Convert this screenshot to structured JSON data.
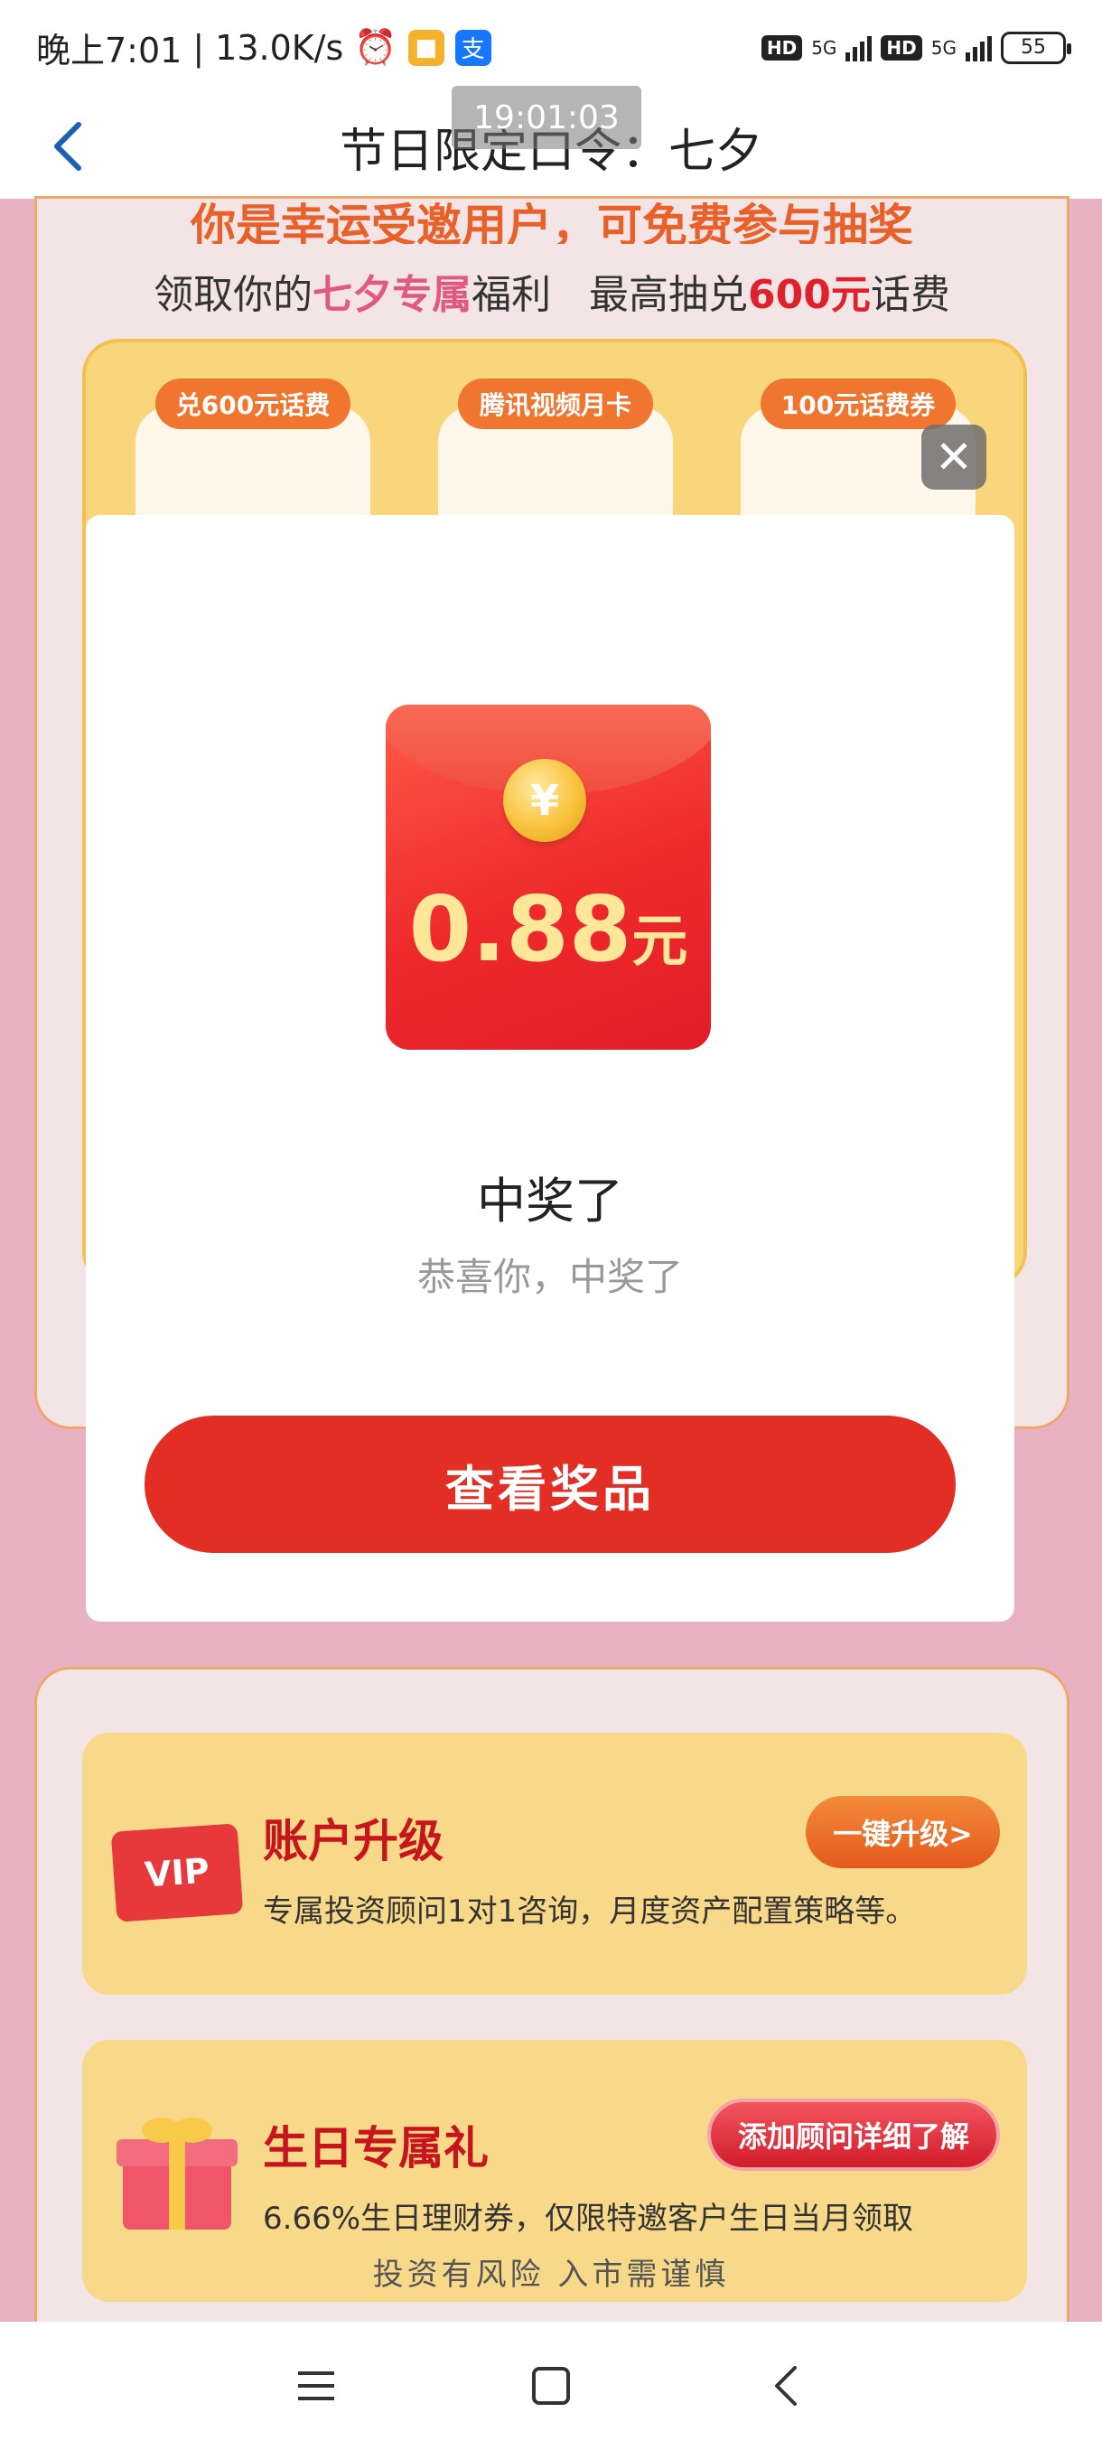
{
  "status_bar": {
    "time": "晚上7:01",
    "speed": "13.0K/s",
    "network1": "5G",
    "network2": "5G",
    "hd1": "HD",
    "hd2": "HD",
    "battery": "55"
  },
  "header": {
    "title": "节日限定口令：七夕",
    "timestamp": "19:01:03"
  },
  "background": {
    "headline": "你是幸运受邀用户，可免费参与抽奖",
    "subline_prefix": "领取你的",
    "subline_highlight": "七夕专属",
    "subline_mid": "福利   最高抽兑",
    "subline_amount": "600元",
    "subline_suffix": "话费",
    "prize_tags": [
      "兑600元话费",
      "腾讯视频月卡",
      "100元话费券"
    ],
    "features": [
      {
        "badge": "VIP",
        "title": "账户升级",
        "desc": "专属投资顾问1对1咨询，月度资产配置策略等。",
        "button": "一键升级>"
      },
      {
        "title": "生日专属礼",
        "desc": "6.66%生日理财券，仅限特邀客户生日当月领取",
        "button": "添加顾问详细了解"
      }
    ],
    "footer_note": "投资有风险 入市需谨慎"
  },
  "modal": {
    "close_icon": "close-icon",
    "coin_symbol": "¥",
    "amount": "0.88",
    "unit": "元",
    "heading": "中奖了",
    "subtext": "恭喜你，中奖了",
    "button_label": "查看奖品"
  },
  "colors": {
    "primary_button": "#e32e25",
    "envelope": "#ee2a2b",
    "amount_text": "#ffe79a",
    "page_background": "#e9b2c3"
  }
}
